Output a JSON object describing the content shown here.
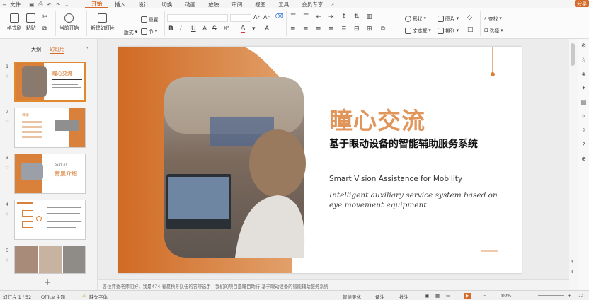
{
  "menu": {
    "file": "文件",
    "tabs": [
      "开始",
      "插入",
      "设计",
      "切换",
      "动画",
      "放映",
      "审阅",
      "视图",
      "工具",
      "会员专享"
    ],
    "active_tab": "开始",
    "share": "分享"
  },
  "toolbar": {
    "format_painter": "格式刷",
    "paste": "粘贴",
    "from_current": "当前开始",
    "new_slide": "新建幻灯片",
    "layout": "版式",
    "section": "节",
    "reset": "重置",
    "shape": "形状",
    "picture": "图片",
    "textbox": "文本框",
    "arrange": "排列",
    "find": "查找",
    "select": "选择"
  },
  "panel": {
    "tab_outline": "大纲",
    "tab_slides": "幻灯片",
    "thumb_numbers": [
      "1",
      "2",
      "3",
      "4",
      "5"
    ],
    "thumb1_title": "瞳心交流",
    "thumb2_title": "目录",
    "thumb3_title": "背景介绍",
    "thumb3_part": "PART 01"
  },
  "slide": {
    "title": "瞳心交流",
    "subtitle": "基于眼动设备的智能辅助服务系统",
    "en_title": "Smart Vision Assistance for Mobility",
    "en_desc_1": "Intelligent auxiliary service system based on",
    "en_desc_2": "eye movement equipment"
  },
  "notes": "各位评委老师们好，我是474-春夏秋冬队伍的答辩选手，我们的项目是瞳目助行-基于眼动设备的智能辅助服务系统",
  "status": {
    "slide_counter": "幻灯片 1 / 52",
    "theme": "Office 主题",
    "missing_font": "缺失字体",
    "smart_beautify": "智能美化",
    "notes_btn": "备注",
    "comments": "批注",
    "zoom": "80%"
  },
  "colors": {
    "accent": "#d46b2a",
    "title_orange": "#e0955a",
    "slide_orange": "#d9803a"
  }
}
